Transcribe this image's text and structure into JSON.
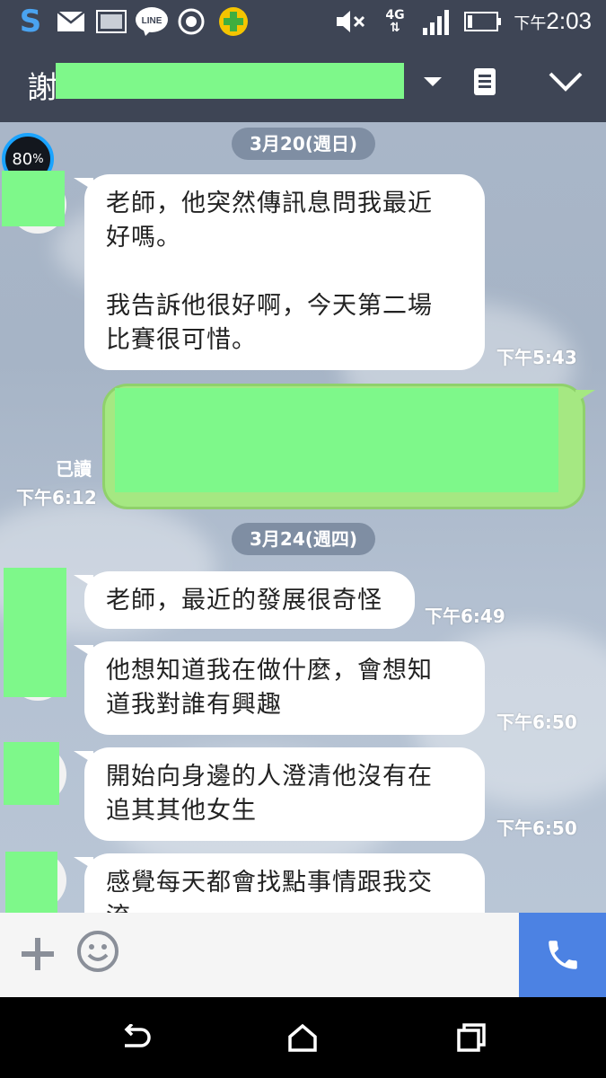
{
  "status_bar": {
    "time": "2:03",
    "time_prefix": "下午",
    "network": "4G",
    "icons": [
      "s-app-icon",
      "mail-icon",
      "gallery-icon",
      "line-icon",
      "target-icon",
      "plus-app-icon",
      "mute-icon",
      "signal-icon",
      "battery-icon"
    ]
  },
  "header": {
    "title": "謝",
    "icons": [
      "chevron-down-icon",
      "notes-icon",
      "collapse-icon"
    ]
  },
  "overlay": {
    "progress": "80",
    "progress_unit": "%"
  },
  "chat": {
    "dates": [
      "3月20(週日)",
      "3月24(週四)"
    ],
    "messages": [
      {
        "text": "老師，他突然傳訊息問我最近\n好嗎。\n\n我告訴他很好啊，今天第二場\n比賽很可惜。",
        "time": "下午5:43"
      },
      {
        "read": "已讀",
        "time": "下午6:12"
      },
      {
        "text": "老師，最近的發展很奇怪",
        "time": "下午6:49"
      },
      {
        "text": "他想知道我在做什麼，會想知\n道我對誰有興趣",
        "time": "下午6:50"
      },
      {
        "text": "開始向身邊的人澄清他沒有在\n追其其他女生",
        "time": "下午6:50"
      },
      {
        "text": "感覺每天都會找點事情跟我交\n流",
        "time": ""
      }
    ]
  },
  "input_bar": {
    "icons": [
      "plus-icon",
      "emoji-icon",
      "phone-icon"
    ]
  },
  "nav_bar": {
    "icons": [
      "back-icon",
      "home-icon",
      "recent-apps-icon"
    ]
  },
  "colors": {
    "header": "#3e4555",
    "outgoing": "#a5e882",
    "call": "#4c82e3",
    "mask": "#7ef88a"
  }
}
